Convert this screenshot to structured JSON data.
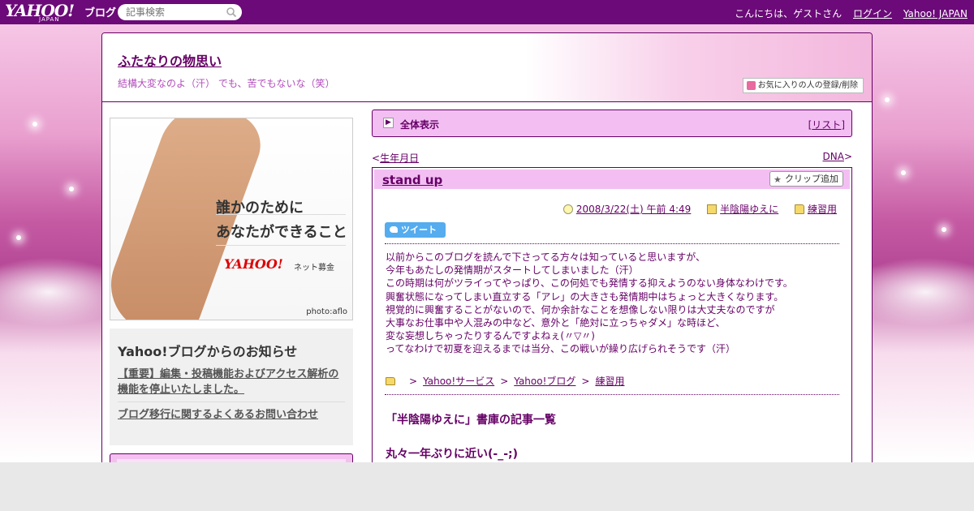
{
  "topbar": {
    "logo_main": "YAHOO!",
    "logo_sub": "JAPAN",
    "logo_blog": "ブログ",
    "search_placeholder": "記事検索",
    "greeting": "こんにちは、ゲストさん",
    "login": "ログイン",
    "yahoo_japan": "Yahoo! JAPAN"
  },
  "header": {
    "title": "ふたなりの物思い",
    "subtitle": "結構大変なのよ（汗） でも、苦でもないな（笑）",
    "fav_button": "お気に入りの人の登録/削除"
  },
  "ad": {
    "line1": "誰かのために",
    "line2": "あなたができること",
    "brand": "YAHOO!",
    "brand_sub": "ネット募金",
    "credit": "photo:aflo"
  },
  "notice": {
    "heading": "Yahoo!ブログからのお知らせ",
    "link1": "【重要】編集・投稿機能およびアクセス解析の機能を停止いたしました。",
    "link2": "ブログ移行に関するよくあるお問い合わせ"
  },
  "section": {
    "label": "全体表示",
    "list_open": "[",
    "list": "リスト",
    "list_close": "]"
  },
  "nav": {
    "prev_arrow": "<",
    "prev": "生年月日",
    "next": "DNA",
    "next_arrow": ">"
  },
  "article": {
    "title": "stand up",
    "clip": "クリップ追加",
    "date": "2008/3/22(土) 午前 4:49",
    "author": "半陰陽ゆえに",
    "category": "練習用",
    "tweet": "ツイート",
    "body": "以前からこのブログを読んで下さってる方々は知っていると思いますが、\n今年もあたしの発情期がスタートしてしまいました（汗）\nこの時期は何がツライってやっぱり、この何処でも発情する抑えようのない身体なわけです。\n興奮状態になってしまい直立する「アレ」の大きさも発情期中はちょっと大きくなります。\n視覚的に興奮することがないので、何か余計なことを想像しない限りは大丈夫なのですが\n大事なお仕事中や人混みの中など、意外と「絶対に立っちゃダメ」な時ほど、\n変な妄想しちゃったりするんですよねぇ(〃▽〃)\nってなわけで初夏を迎えるまでは当分、この戦いが繰り広げられそうです（汗）",
    "breadcrumb": [
      "Yahoo!サービス",
      "Yahoo!ブログ",
      "練習用"
    ],
    "breadcrumb_sep": ">",
    "library_heading": "「半陰陽ゆえに」書庫の記事一覧",
    "next_post": "丸々一年ぶりに近い(-_-;)"
  },
  "icons": [
    "search-icon",
    "heart-icon",
    "arrow-icon",
    "star-icon",
    "clock-icon",
    "book-icon",
    "folder-icon",
    "twitter-bird-icon"
  ],
  "colors": {
    "topbar": "#6b0a78",
    "accent": "#660066",
    "section_bg": "#f3bff3",
    "text_purple": "#b24dbc"
  }
}
